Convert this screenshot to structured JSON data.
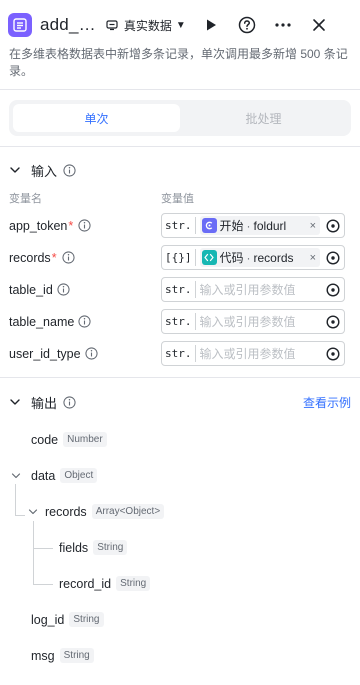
{
  "header": {
    "node_title": "add_…",
    "env_label": "真实数据",
    "icons": [
      "node-list-icon",
      "env-icon",
      "run-icon",
      "help-icon",
      "more-icon",
      "close-icon"
    ]
  },
  "description": "在多维表格数据表中新增多条记录，单次调用最多新增 500 条记录。",
  "tabs": {
    "single": "单次",
    "batch": "批处理"
  },
  "inputs_section": {
    "title": "输入",
    "col_name": "变量名",
    "col_value": "变量值",
    "rows": [
      {
        "name": "app_token",
        "required": "*",
        "type": "str.",
        "ref_label": "开始",
        "ref_var": "foldurl",
        "clear": "×"
      },
      {
        "name": "records",
        "required": "*",
        "type": "[{}]",
        "ref_label": "代码",
        "ref_var": "records",
        "clear": "×"
      },
      {
        "name": "table_id",
        "type": "str.",
        "placeholder": "输入或引用参数值"
      },
      {
        "name": "table_name",
        "type": "str.",
        "placeholder": "输入或引用参数值"
      },
      {
        "name": "user_id_type",
        "type": "str.",
        "placeholder": "输入或引用参数值"
      }
    ],
    "ref_sep": "·"
  },
  "outputs_section": {
    "title": "输出",
    "view_example": "查看示例",
    "fields": [
      {
        "name": "code",
        "type": "Number"
      },
      {
        "name": "data",
        "type": "Object"
      },
      {
        "name": "records",
        "type": "Array<Object>"
      },
      {
        "name": "fields",
        "type": "String"
      },
      {
        "name": "record_id",
        "type": "String"
      },
      {
        "name": "log_id",
        "type": "String"
      },
      {
        "name": "msg",
        "type": "String"
      }
    ]
  },
  "colors": {
    "accent": "#3370ff",
    "node_icon": "#7b61ff",
    "start_ref": "#6a6cf6",
    "code_ref": "#16b7b3",
    "required": "#f54a45"
  }
}
